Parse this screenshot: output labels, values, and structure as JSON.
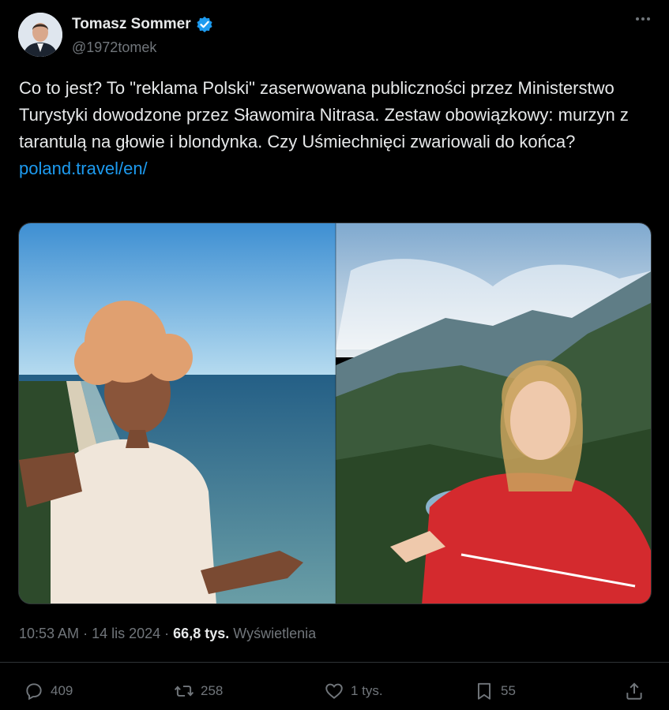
{
  "author": {
    "name": "Tomasz Sommer",
    "handle": "@1972tomek"
  },
  "tweet": {
    "text": "Co to jest? To \"reklama Polski\" zaserwowana publiczności przez Ministerstwo Turystyki dowodzone przez Sławomira Nitrasa. Zestaw obowiązkowy: murzyn z tarantulą na głowie i blondynka. Czy Uśmiechnięci zwariowali do końca?",
    "link": "poland.travel/en/"
  },
  "meta": {
    "time": "10:53 AM",
    "date": "14 lis 2024",
    "views_count": "66,8 tys.",
    "views_label": "Wyświetlenia"
  },
  "actions": {
    "replies": "409",
    "reposts": "258",
    "likes": "1 tys.",
    "bookmarks": "55"
  },
  "colors": {
    "background": "#000000",
    "text": "#e7e9ea",
    "muted": "#71767b",
    "link": "#1d9bf0",
    "verified": "#1d9bf0",
    "shirt_red": "#d42a2e"
  },
  "icons": [
    "verified-badge-icon",
    "more-icon",
    "reply-icon",
    "repost-icon",
    "like-icon",
    "bookmark-icon",
    "share-icon"
  ]
}
